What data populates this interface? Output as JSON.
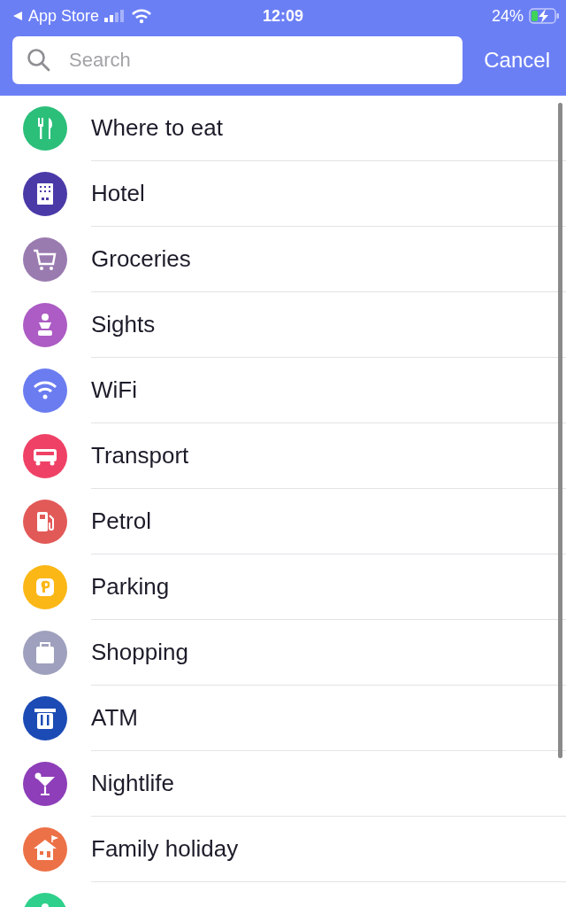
{
  "status_bar": {
    "back_label": "App Store",
    "time": "12:09",
    "battery": "24%"
  },
  "search": {
    "placeholder": "Search",
    "cancel": "Cancel"
  },
  "categories": [
    {
      "label": "Where to eat",
      "kind": "food",
      "color": "#2bbf7a"
    },
    {
      "label": "Hotel",
      "kind": "hotel",
      "color": "#4a3aa8"
    },
    {
      "label": "Groceries",
      "kind": "cart",
      "color": "#9a7bb0"
    },
    {
      "label": "Sights",
      "kind": "bust",
      "color": "#ac5cc4"
    },
    {
      "label": "WiFi",
      "kind": "wifi",
      "color": "#6a7cf0"
    },
    {
      "label": "Transport",
      "kind": "bus",
      "color": "#ef4166"
    },
    {
      "label": "Petrol",
      "kind": "fuel",
      "color": "#e25a58"
    },
    {
      "label": "Parking",
      "kind": "parking",
      "color": "#fbb716"
    },
    {
      "label": "Shopping",
      "kind": "bag",
      "color": "#9fa0bd"
    },
    {
      "label": "ATM",
      "kind": "atm",
      "color": "#1c4bb5"
    },
    {
      "label": "Nightlife",
      "kind": "cocktail",
      "color": "#8d3eb8"
    },
    {
      "label": "Family holiday",
      "kind": "house",
      "color": "#ec7147"
    },
    {
      "kind": "bust",
      "color": "#2fd08c"
    }
  ]
}
